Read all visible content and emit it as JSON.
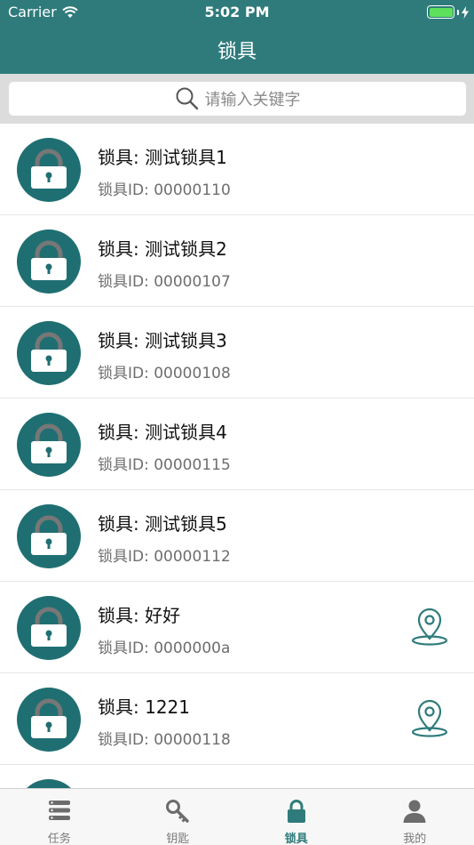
{
  "status_bar": {
    "carrier": "Carrier",
    "time": "5:02 PM"
  },
  "nav": {
    "title": "锁具"
  },
  "search": {
    "placeholder": "请输入关键字"
  },
  "colors": {
    "primary": "#2f7b7b",
    "avatar": "#1f6f72",
    "battery": "#5de05b"
  },
  "locks": [
    {
      "title": "锁具: 测试锁具1",
      "id": "锁具ID: 00000110",
      "has_location": false
    },
    {
      "title": "锁具: 测试锁具2",
      "id": "锁具ID: 00000107",
      "has_location": false
    },
    {
      "title": "锁具: 测试锁具3",
      "id": "锁具ID: 00000108",
      "has_location": false
    },
    {
      "title": "锁具: 测试锁具4",
      "id": "锁具ID: 00000115",
      "has_location": false
    },
    {
      "title": "锁具: 测试锁具5",
      "id": "锁具ID: 00000112",
      "has_location": false
    },
    {
      "title": "锁具: 好好",
      "id": "锁具ID: 0000000a",
      "has_location": true
    },
    {
      "title": "锁具: 1221",
      "id": "锁具ID: 00000118",
      "has_location": true
    },
    {
      "title": "",
      "id": "",
      "has_location": false
    }
  ],
  "tabs": [
    {
      "label": "任务",
      "icon": "task-list-icon",
      "active": false
    },
    {
      "label": "钥匙",
      "icon": "key-icon",
      "active": false
    },
    {
      "label": "锁具",
      "icon": "padlock-icon",
      "active": true
    },
    {
      "label": "我的",
      "icon": "user-icon",
      "active": false
    }
  ]
}
